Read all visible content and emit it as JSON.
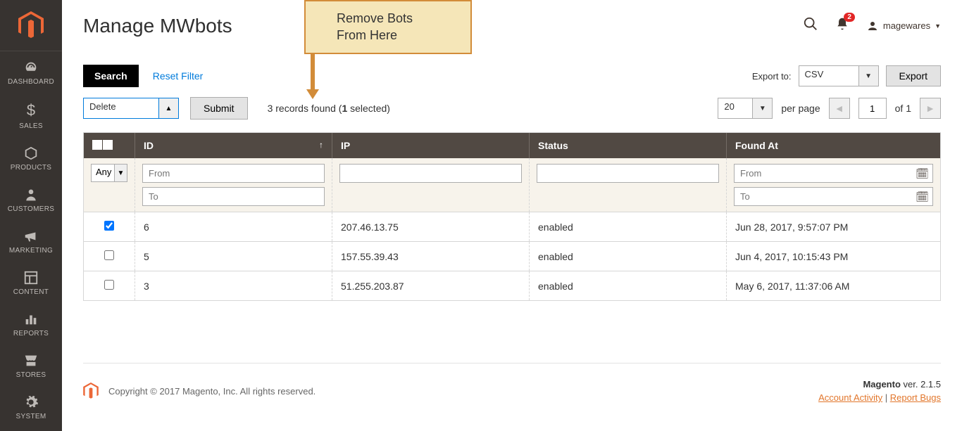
{
  "sidebar": {
    "items": [
      {
        "label": "DASHBOARD"
      },
      {
        "label": "SALES"
      },
      {
        "label": "PRODUCTS"
      },
      {
        "label": "CUSTOMERS"
      },
      {
        "label": "MARKETING"
      },
      {
        "label": "CONTENT"
      },
      {
        "label": "REPORTS"
      },
      {
        "label": "STORES"
      },
      {
        "label": "SYSTEM"
      }
    ]
  },
  "header": {
    "title": "Manage MWbots",
    "callout_line1": "Remove Bots",
    "callout_line2": "From Here",
    "notifications_count": "2",
    "user_name": "magewares"
  },
  "toolbar": {
    "search_label": "Search",
    "reset_label": "Reset Filter",
    "export_to_label": "Export to:",
    "export_format": "CSV",
    "export_button": "Export"
  },
  "toolbar2": {
    "action_value": "Delete",
    "submit_label": "Submit",
    "records_found_num": "3",
    "records_found_text": " records found (",
    "records_selected": "1",
    "records_selected_suffix": " selected)",
    "page_size": "20",
    "per_page_label": "per page",
    "page_current": "1",
    "page_total_label": "of 1"
  },
  "grid": {
    "columns": {
      "id": "ID",
      "ip": "IP",
      "status": "Status",
      "found_at": "Found At"
    },
    "filters": {
      "any": "Any",
      "from_ph": "From",
      "to_ph": "To"
    },
    "rows": [
      {
        "checked": true,
        "id": "6",
        "ip": "207.46.13.75",
        "status": "enabled",
        "found_at": "Jun 28, 2017, 9:57:07 PM"
      },
      {
        "checked": false,
        "id": "5",
        "ip": "157.55.39.43",
        "status": "enabled",
        "found_at": "Jun 4, 2017, 10:15:43 PM"
      },
      {
        "checked": false,
        "id": "3",
        "ip": "51.255.203.87",
        "status": "enabled",
        "found_at": "May 6, 2017, 11:37:06 AM"
      }
    ]
  },
  "footer": {
    "copyright": "Copyright © 2017 Magento, Inc. All rights reserved.",
    "brand": "Magento",
    "version": " ver. 2.1.5",
    "link_activity": "Account Activity",
    "link_bugs": "Report Bugs",
    "sep": " | "
  }
}
